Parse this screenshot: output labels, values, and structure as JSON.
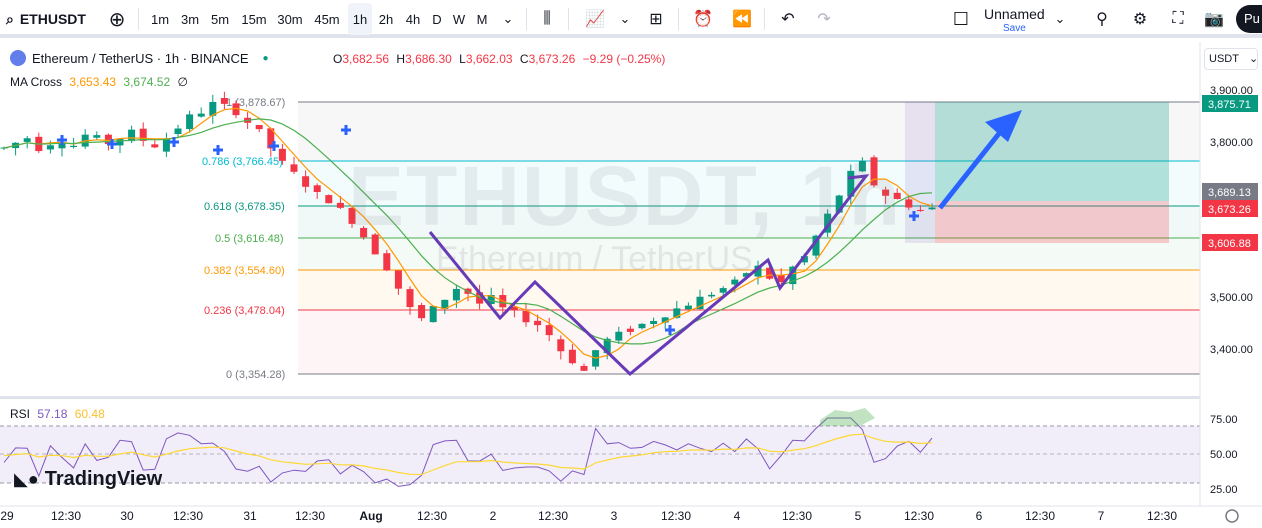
{
  "toolbar": {
    "symbol": "ETHUSDT",
    "intervals": [
      "1m",
      "3m",
      "5m",
      "15m",
      "30m",
      "45m",
      "1h",
      "2h",
      "4h",
      "D",
      "W",
      "M"
    ],
    "active_interval": "1h",
    "layout_name": "Unnamed",
    "save_label": "Save",
    "publish_label": "Pu"
  },
  "legend": {
    "title": "Ethereum / TetherUS · 1h · BINANCE",
    "open_label": "O",
    "open": "3,682.56",
    "high_label": "H",
    "high": "3,686.30",
    "low_label": "L",
    "low": "3,662.03",
    "close_label": "C",
    "close": "3,673.26",
    "change": "−9.29 (−0.25%)",
    "indicator_name": "MA Cross",
    "ma1": "3,653.43",
    "ma2": "3,674.52",
    "indicator_symbol": "∅"
  },
  "rsi": {
    "name": "RSI",
    "value": "57.18",
    "ma": "60.48"
  },
  "currency": "USDT",
  "watermark": {
    "main": "ETHUSDT, 1h",
    "sub": "Ethereum / TetherUS"
  },
  "brand": "TradingView",
  "colors": {
    "up": "#089981",
    "down": "#f23645",
    "accent": "#2962ff",
    "pattern": "#673ab7"
  },
  "chart_data": {
    "type": "candlestick",
    "price_axis": [
      "3,900.00",
      "3,800.00",
      "3,500.00",
      "3,400.00"
    ],
    "price_tags": [
      {
        "value": "3,875.71",
        "color": "#089981"
      },
      {
        "value": "3,689.13",
        "color": "#787b86"
      },
      {
        "value": "3,673.26",
        "color": "#f23645"
      },
      {
        "value": "3,606.88",
        "color": "#f23645"
      }
    ],
    "fib_levels": [
      {
        "label": "1 (3,878.67)",
        "color": "#787b86"
      },
      {
        "label": "0.786 (3,766.45)",
        "color": "#00bcd4"
      },
      {
        "label": "0.618 (3,678.35)",
        "color": "#089981"
      },
      {
        "label": "0.5 (3,616.48)",
        "color": "#4caf50"
      },
      {
        "label": "0.382 (3,554.60)",
        "color": "#ff9800"
      },
      {
        "label": "0.236 (3,478.04)",
        "color": "#f23645"
      },
      {
        "label": "0 (3,354.28)",
        "color": "#787b86"
      }
    ],
    "rsi_axis": [
      "75.00",
      "50.00",
      "25.00"
    ],
    "time_axis": [
      "29",
      "12:30",
      "30",
      "12:30",
      "31",
      "12:30",
      "Aug",
      "12:30",
      "2",
      "12:30",
      "3",
      "12:30",
      "4",
      "12:30",
      "5",
      "12:30",
      "6",
      "12:30",
      "7",
      "12:30"
    ],
    "price_ylim": [
      3354.28,
      3878.67
    ],
    "close_approx": [
      3790,
      3800,
      3810,
      3790,
      3800,
      3805,
      3795,
      3815,
      3808,
      3800,
      3810,
      3820,
      3805,
      3795,
      3810,
      3830,
      3850,
      3860,
      3875,
      3870,
      3860,
      3840,
      3820,
      3790,
      3760,
      3740,
      3720,
      3700,
      3690,
      3670,
      3650,
      3620,
      3590,
      3560,
      3520,
      3480,
      3460,
      3480,
      3500,
      3520,
      3510,
      3490,
      3500,
      3480,
      3470,
      3460,
      3450,
      3430,
      3400,
      3380,
      3360,
      3400,
      3420,
      3430,
      3440,
      3450,
      3460,
      3470,
      3480,
      3490,
      3500,
      3510,
      3520,
      3530,
      3550,
      3560,
      3540,
      3530,
      3560,
      3580,
      3620,
      3660,
      3700,
      3740,
      3760,
      3720,
      3700,
      3690,
      3680,
      3670,
      3673
    ]
  }
}
